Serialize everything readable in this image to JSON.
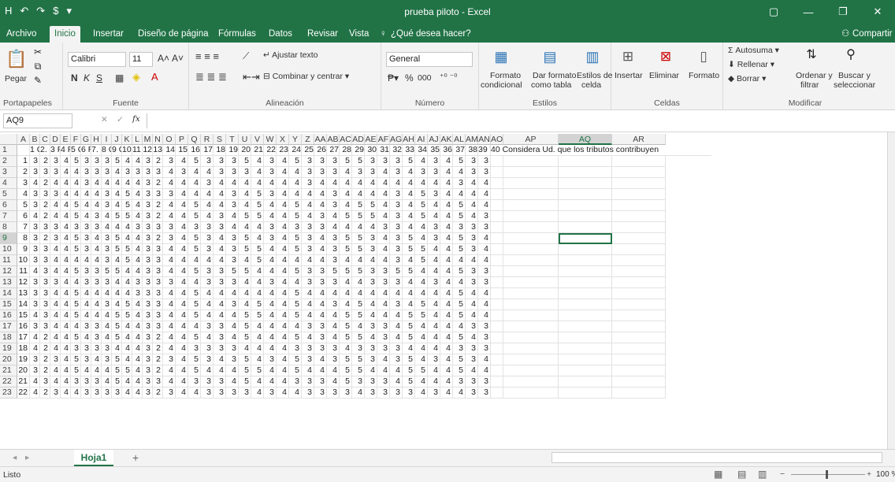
{
  "window": {
    "title": "prueba piloto - Excel",
    "qat": [
      "H",
      "↶",
      "↷",
      "$",
      "▾"
    ],
    "controls": [
      "▢",
      "—",
      "❐",
      "✕"
    ]
  },
  "tabs": [
    {
      "label": "Archivo"
    },
    {
      "label": "Inicio"
    },
    {
      "label": "Insertar"
    },
    {
      "label": "Diseño de página"
    },
    {
      "label": "Fórmulas"
    },
    {
      "label": "Datos"
    },
    {
      "label": "Revisar"
    },
    {
      "label": "Vista"
    }
  ],
  "tell_me": "¿Qué desea hacer?",
  "share_label": "Compartir",
  "ribbon": {
    "clipboard": {
      "label": "Portapapeles",
      "paste": "Pegar"
    },
    "font": {
      "label": "Fuente",
      "name": "Calibri",
      "size": "11",
      "bold": "N",
      "italic": "K",
      "underline": "S"
    },
    "alignment": {
      "label": "Alineación",
      "wrap": "Ajustar texto",
      "merge": "Combinar y centrar"
    },
    "number": {
      "label": "Número",
      "format": "General",
      "percent": "%",
      "thousands": "000"
    },
    "styles": {
      "label": "Estilos",
      "conditional": [
        "Formato",
        "condicional"
      ],
      "as_table": [
        "Dar formato",
        "como tabla"
      ],
      "cell_styles": [
        "Estilos de",
        "celda"
      ]
    },
    "cells": {
      "label": "Celdas",
      "insert": "Insertar",
      "delete": "Eliminar",
      "format": "Formato"
    },
    "editing": {
      "label": "Modificar",
      "autosum": "Autosuma",
      "fill": "Rellenar",
      "clear": "Borrar",
      "sort": [
        "Ordenar y",
        "filtrar"
      ],
      "find": [
        "Buscar y",
        "seleccionar"
      ]
    }
  },
  "formula_bar": {
    "name_box": "AQ9",
    "fx": "fx",
    "formula": ""
  },
  "columns": [
    "A",
    "B",
    "C",
    "D",
    "E",
    "F",
    "G",
    "H",
    "I",
    "J",
    "K",
    "L",
    "M",
    "N",
    "O",
    "P",
    "Q",
    "R",
    "S",
    "T",
    "U",
    "V",
    "W",
    "X",
    "Y",
    "Z",
    "AA",
    "AB",
    "AC",
    "AD",
    "AE",
    "AF",
    "AG",
    "AH",
    "AI",
    "AJ",
    "AK",
    "AL",
    "AM",
    "AN",
    "AO",
    "AP",
    "AQ",
    "AR"
  ],
  "row_numbers": [
    "1",
    "2",
    "3",
    "4",
    "5",
    "6",
    "7",
    "8",
    "9",
    "10",
    "11",
    "12",
    "13",
    "14",
    "15",
    "16",
    "17",
    "18",
    "19",
    "20",
    "21",
    "22",
    "23"
  ],
  "header_row": [
    "",
    "1 Cd",
    "2. Se",
    "3 Pr",
    "4 Pr",
    "5 Cc",
    "6 Re",
    "7. R",
    "8 Ge",
    "9 Cu",
    "10 C",
    "11 N",
    "12",
    "13",
    "14",
    "15",
    "16",
    "17",
    "18",
    "19",
    "20",
    "21",
    "22",
    "23",
    "24",
    "25",
    "26",
    "27",
    "28",
    "29",
    "30",
    "31",
    "32",
    "33",
    "34",
    "35",
    "36",
    "37",
    "38",
    "39 T",
    "40 Considera Ud. que los tributos contribuyen"
  ],
  "rows": [
    [
      1,
      3,
      2,
      3,
      4,
      5,
      3,
      3,
      3,
      5,
      4,
      4,
      3,
      2,
      3,
      4,
      5,
      3,
      3,
      3,
      5,
      4,
      3,
      4,
      5,
      3,
      3,
      3,
      5,
      5,
      3,
      3,
      3,
      5,
      4,
      3,
      4,
      5,
      3,
      3
    ],
    [
      2,
      3,
      3,
      3,
      4,
      4,
      3,
      3,
      3,
      4,
      3,
      3,
      3,
      3,
      4,
      3,
      4,
      4,
      3,
      3,
      3,
      4,
      3,
      4,
      4,
      3,
      3,
      3,
      4,
      3,
      3,
      4,
      3,
      4,
      3,
      3,
      4,
      4,
      3,
      3
    ],
    [
      3,
      4,
      2,
      4,
      4,
      4,
      3,
      4,
      4,
      4,
      4,
      4,
      3,
      2,
      4,
      4,
      4,
      3,
      4,
      4,
      4,
      4,
      4,
      4,
      4,
      3,
      4,
      4,
      4,
      4,
      4,
      4,
      4,
      4,
      4,
      4,
      4,
      3,
      4,
      4
    ],
    [
      4,
      3,
      3,
      3,
      4,
      4,
      4,
      4,
      3,
      4,
      5,
      4,
      3,
      3,
      3,
      4,
      4,
      4,
      4,
      3,
      4,
      5,
      3,
      4,
      4,
      4,
      4,
      3,
      4,
      4,
      4,
      4,
      3,
      4,
      5,
      3,
      4,
      4,
      4,
      4
    ],
    [
      5,
      3,
      2,
      4,
      4,
      5,
      4,
      4,
      3,
      4,
      5,
      4,
      3,
      2,
      4,
      4,
      5,
      4,
      4,
      3,
      4,
      5,
      4,
      4,
      5,
      4,
      4,
      3,
      4,
      5,
      5,
      4,
      3,
      4,
      5,
      4,
      4,
      5,
      4,
      4
    ],
    [
      6,
      4,
      2,
      4,
      4,
      5,
      4,
      3,
      4,
      5,
      5,
      4,
      3,
      2,
      4,
      4,
      5,
      4,
      3,
      4,
      5,
      5,
      4,
      4,
      5,
      4,
      3,
      4,
      5,
      5,
      5,
      4,
      3,
      4,
      5,
      4,
      4,
      5,
      4,
      3
    ],
    [
      7,
      3,
      3,
      3,
      4,
      3,
      3,
      3,
      4,
      4,
      4,
      3,
      3,
      3,
      3,
      4,
      3,
      3,
      3,
      4,
      4,
      4,
      3,
      4,
      3,
      3,
      3,
      4,
      4,
      4,
      4,
      3,
      3,
      4,
      4,
      3,
      4,
      3,
      3,
      3
    ],
    [
      8,
      3,
      2,
      3,
      4,
      5,
      3,
      4,
      3,
      5,
      4,
      4,
      3,
      2,
      3,
      4,
      5,
      3,
      4,
      3,
      5,
      4,
      3,
      4,
      5,
      3,
      4,
      3,
      5,
      5,
      3,
      4,
      3,
      5,
      4,
      3,
      4,
      5,
      3,
      4
    ],
    [
      9,
      3,
      3,
      4,
      4,
      5,
      3,
      4,
      3,
      5,
      5,
      4,
      3,
      3,
      4,
      4,
      5,
      3,
      4,
      3,
      5,
      5,
      4,
      4,
      5,
      3,
      4,
      3,
      5,
      5,
      3,
      4,
      3,
      5,
      5,
      4,
      4,
      5,
      3,
      4
    ],
    [
      10,
      3,
      3,
      4,
      4,
      4,
      4,
      4,
      3,
      4,
      5,
      4,
      3,
      3,
      4,
      4,
      4,
      4,
      4,
      3,
      4,
      5,
      4,
      4,
      4,
      4,
      4,
      3,
      4,
      4,
      4,
      4,
      3,
      4,
      5,
      4,
      4,
      4,
      4,
      4
    ],
    [
      11,
      4,
      3,
      4,
      4,
      5,
      3,
      3,
      5,
      5,
      4,
      4,
      3,
      3,
      4,
      4,
      5,
      3,
      3,
      5,
      5,
      4,
      4,
      4,
      5,
      3,
      3,
      5,
      5,
      5,
      3,
      3,
      5,
      5,
      4,
      4,
      4,
      5,
      3,
      3
    ],
    [
      12,
      3,
      3,
      3,
      4,
      4,
      3,
      3,
      3,
      4,
      4,
      3,
      3,
      3,
      3,
      4,
      4,
      3,
      3,
      3,
      4,
      4,
      3,
      4,
      4,
      3,
      3,
      3,
      4,
      4,
      3,
      3,
      3,
      4,
      4,
      3,
      4,
      4,
      3,
      3
    ],
    [
      13,
      3,
      3,
      4,
      4,
      5,
      4,
      4,
      4,
      4,
      4,
      3,
      3,
      3,
      4,
      4,
      5,
      4,
      4,
      4,
      4,
      4,
      4,
      4,
      5,
      4,
      4,
      4,
      4,
      4,
      4,
      4,
      4,
      4,
      4,
      4,
      4,
      5,
      4,
      4
    ],
    [
      14,
      3,
      3,
      4,
      4,
      5,
      4,
      4,
      3,
      4,
      5,
      4,
      3,
      3,
      4,
      4,
      5,
      4,
      4,
      3,
      4,
      5,
      4,
      4,
      5,
      4,
      4,
      3,
      4,
      5,
      4,
      4,
      3,
      4,
      5,
      4,
      4,
      5,
      4,
      4
    ],
    [
      15,
      4,
      3,
      4,
      4,
      5,
      4,
      4,
      4,
      5,
      5,
      4,
      3,
      3,
      4,
      4,
      5,
      4,
      4,
      4,
      5,
      5,
      4,
      4,
      5,
      4,
      4,
      4,
      5,
      5,
      4,
      4,
      4,
      5,
      5,
      4,
      4,
      5,
      4,
      4
    ],
    [
      16,
      3,
      3,
      4,
      4,
      4,
      3,
      3,
      4,
      5,
      4,
      4,
      3,
      3,
      4,
      4,
      4,
      3,
      3,
      4,
      5,
      4,
      4,
      4,
      4,
      3,
      3,
      4,
      5,
      4,
      3,
      3,
      4,
      5,
      4,
      4,
      4,
      4,
      3,
      3
    ],
    [
      17,
      4,
      2,
      4,
      4,
      5,
      4,
      3,
      4,
      5,
      4,
      4,
      3,
      2,
      4,
      4,
      5,
      4,
      3,
      4,
      5,
      4,
      4,
      4,
      5,
      4,
      3,
      4,
      5,
      5,
      4,
      3,
      4,
      5,
      4,
      4,
      4,
      5,
      4,
      3
    ],
    [
      18,
      4,
      2,
      4,
      4,
      3,
      3,
      3,
      3,
      4,
      4,
      4,
      3,
      2,
      4,
      4,
      3,
      3,
      3,
      3,
      4,
      4,
      4,
      4,
      3,
      3,
      3,
      3,
      4,
      3,
      3,
      3,
      3,
      4,
      4,
      4,
      4,
      3,
      3,
      3
    ],
    [
      19,
      3,
      2,
      3,
      4,
      5,
      3,
      4,
      3,
      5,
      4,
      4,
      3,
      2,
      3,
      4,
      5,
      3,
      4,
      3,
      5,
      4,
      3,
      4,
      5,
      3,
      4,
      3,
      5,
      5,
      3,
      4,
      3,
      5,
      4,
      3,
      4,
      5,
      3,
      4
    ],
    [
      20,
      3,
      2,
      4,
      4,
      5,
      4,
      4,
      4,
      5,
      5,
      4,
      3,
      2,
      4,
      4,
      5,
      4,
      4,
      4,
      5,
      5,
      4,
      4,
      5,
      4,
      4,
      4,
      5,
      5,
      4,
      4,
      4,
      5,
      5,
      4,
      4,
      5,
      4,
      4
    ],
    [
      21,
      4,
      3,
      4,
      4,
      3,
      3,
      3,
      4,
      5,
      4,
      4,
      3,
      3,
      4,
      4,
      3,
      3,
      3,
      4,
      5,
      4,
      4,
      4,
      3,
      3,
      3,
      4,
      5,
      3,
      3,
      3,
      4,
      5,
      4,
      4,
      4,
      3,
      3,
      3
    ],
    [
      22,
      4,
      2,
      3,
      4,
      4,
      3,
      3,
      3,
      3,
      4,
      4,
      3,
      2,
      3,
      4,
      4,
      3,
      3,
      3,
      3,
      4,
      3,
      4,
      4,
      3,
      3,
      3,
      3,
      4,
      3,
      3,
      3,
      3,
      4,
      3,
      4,
      4,
      3,
      3
    ]
  ],
  "sheet": {
    "active": "Hoja1",
    "add": "+"
  },
  "status": {
    "ready": "Listo",
    "zoom": "100 %"
  }
}
